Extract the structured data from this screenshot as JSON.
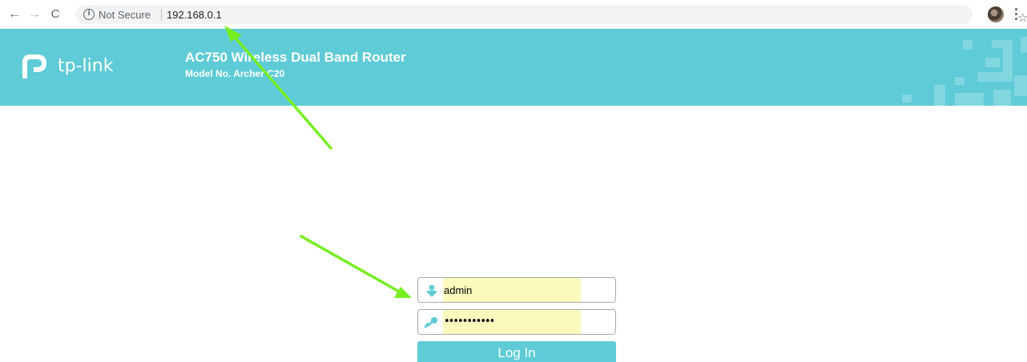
{
  "browser": {
    "security_label": "Not Secure",
    "url": "192.168.0.1"
  },
  "router": {
    "brand": "tp-link",
    "product_name": "AC750 Wireless Dual Band Router",
    "model_number": "Model No. Archer C20",
    "accent_color": "#5ecbd7"
  },
  "login": {
    "username_value": "admin",
    "password_value": "•••••••••••",
    "login_button_label": "Log In",
    "autofill_color": "#fafabd"
  },
  "annotations": {
    "arrow_color": "#77ee22"
  }
}
